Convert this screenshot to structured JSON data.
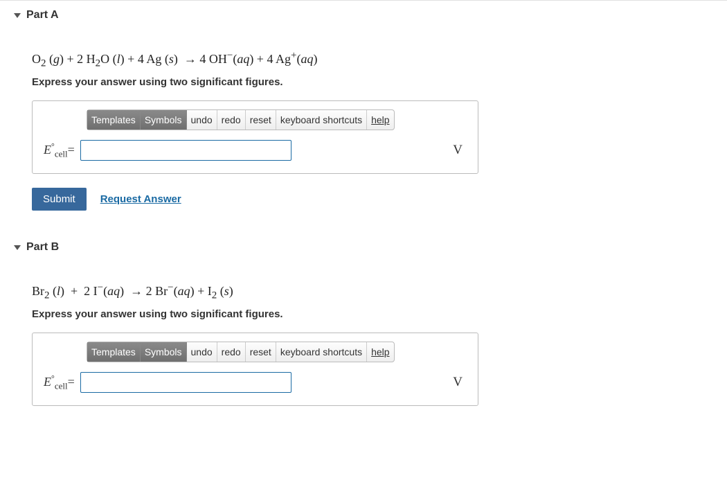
{
  "parts": [
    {
      "title": "Part A",
      "equation_html": "O<sub>2</sub> (<i>g</i>) + 2 H<sub>2</sub>O (<i>l</i>) + 4 Ag (<i>s</i>)  → 4 OH<sup>−</sup>(<i>aq</i>) + 4 Ag<sup>+</sup>(<i>aq</i>)",
      "instruction": "Express your answer using two significant figures.",
      "label_html": "<i>E</i><span class=\"sup\">°</span><span class=\"sub\">cell</span><span class=\"rm\">=</span>",
      "unit": "V",
      "value": ""
    },
    {
      "title": "Part B",
      "equation_html": "Br<sub>2</sub> (<i>l</i>)  +  2 I<sup>−</sup>(<i>aq</i>)  → 2 Br<sup>−</sup>(<i>aq</i>) + I<sub>2</sub> (<i>s</i>)",
      "instruction": "Express your answer using two significant figures.",
      "label_html": "<i>E</i><span class=\"sup\">°</span><span class=\"sub\">cell</span><span class=\"rm\">=</span>",
      "unit": "V",
      "value": ""
    }
  ],
  "toolbar": {
    "templates": "Templates",
    "symbols": "Symbols",
    "undo": "undo",
    "redo": "redo",
    "reset": "reset",
    "kbshort": "keyboard shortcuts",
    "help": "help"
  },
  "submit_label": "Submit",
  "request_answer_label": "Request Answer"
}
